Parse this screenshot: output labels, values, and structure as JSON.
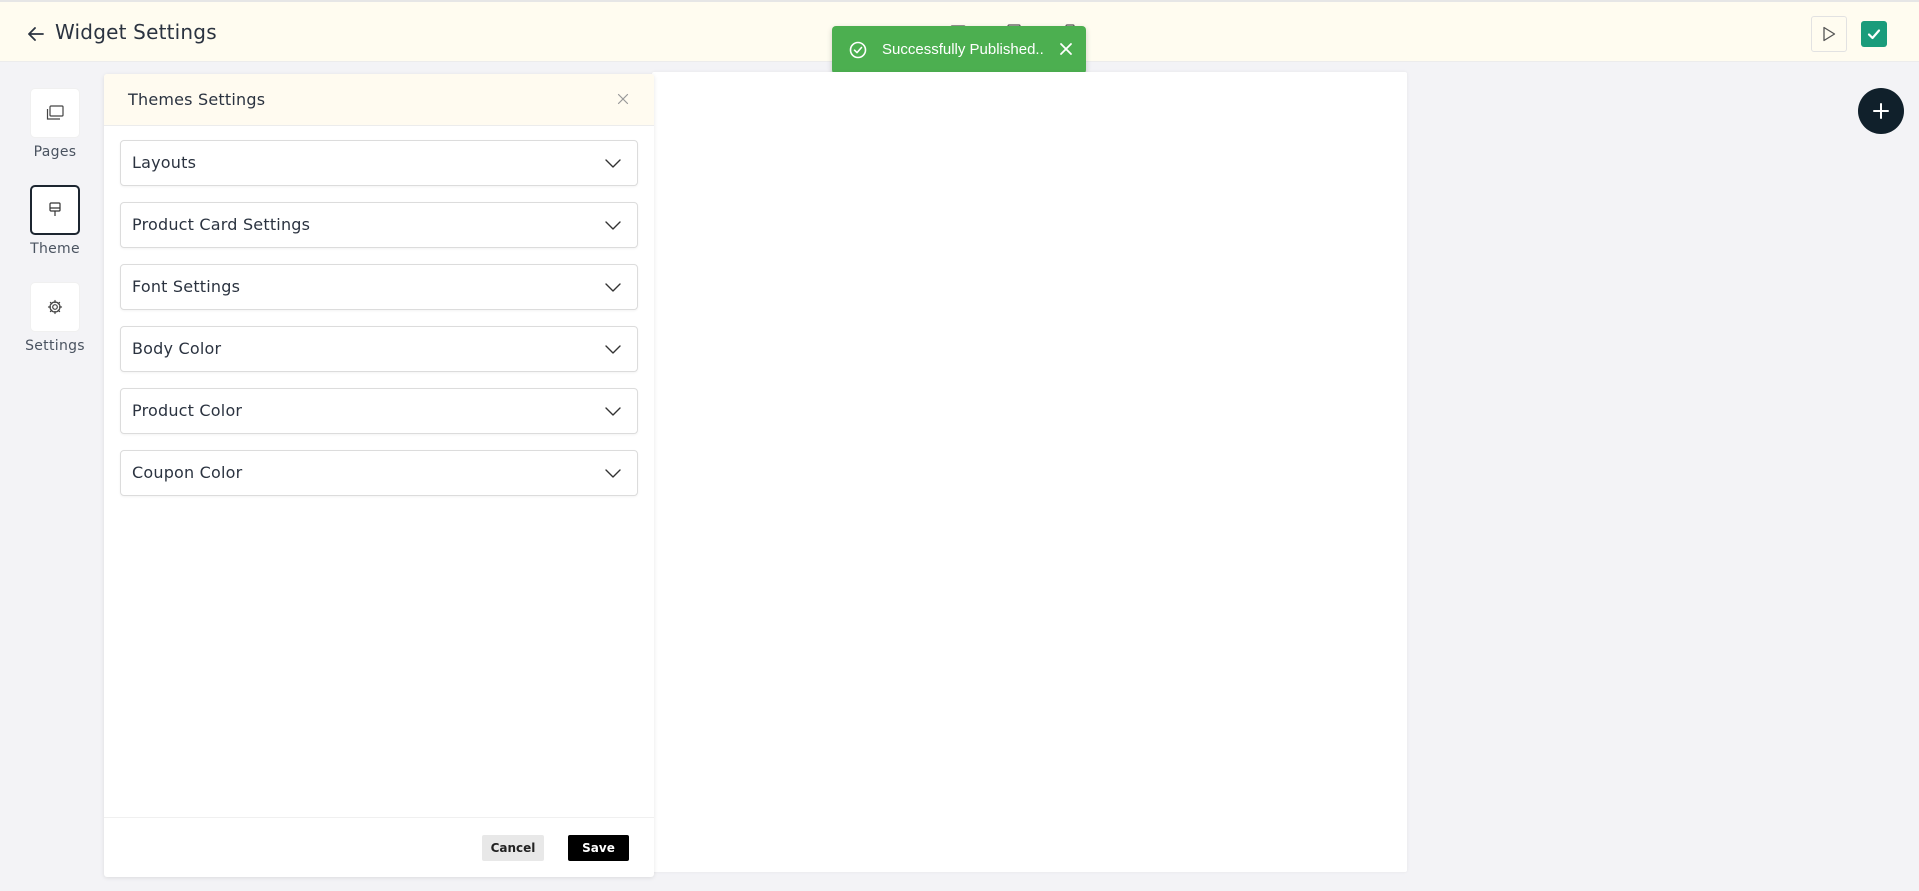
{
  "header": {
    "title": "Widget Settings",
    "back_icon": "arrow-left-icon",
    "preview_icon": "play-icon",
    "publish_icon": "checkbox-checked-icon"
  },
  "toast": {
    "message": "Successfully Published..",
    "icon": "check-circle-icon",
    "color": "#4caf50"
  },
  "sidebar": {
    "items": [
      {
        "label": "Pages",
        "icon": "pages-icon",
        "active": false
      },
      {
        "label": "Theme",
        "icon": "theme-brush-icon",
        "active": true
      },
      {
        "label": "Settings",
        "icon": "gear-icon",
        "active": false
      }
    ]
  },
  "panel": {
    "title": "Themes Settings",
    "sections": [
      {
        "label": "Layouts"
      },
      {
        "label": "Product Card Settings"
      },
      {
        "label": "Font Settings"
      },
      {
        "label": "Body Color"
      },
      {
        "label": "Product Color"
      },
      {
        "label": "Coupon Color"
      }
    ],
    "cancel_label": "Cancel",
    "save_label": "Save"
  },
  "colors": {
    "header_bg": "#fffcf0",
    "publish_accent": "#1a9c7b",
    "fab_bg": "#10202b",
    "save_bg": "#000000"
  }
}
